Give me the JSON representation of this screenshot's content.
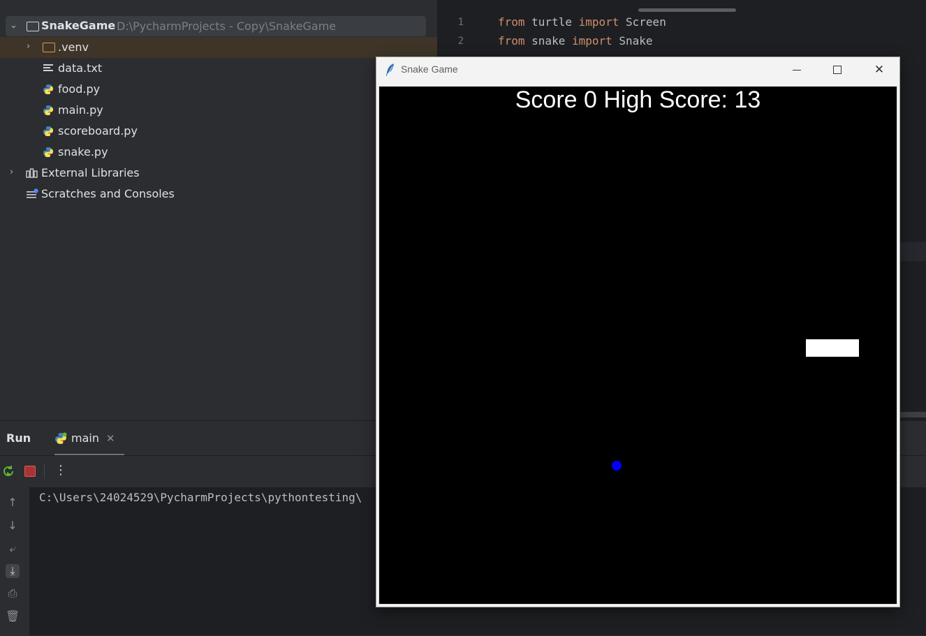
{
  "project": {
    "root_name": "SnakeGame",
    "root_path": "D:\\PycharmProjects - Copy\\SnakeGame",
    "items": [
      {
        "label": ".venv"
      },
      {
        "label": "data.txt"
      },
      {
        "label": "food.py"
      },
      {
        "label": "main.py"
      },
      {
        "label": "scoreboard.py"
      },
      {
        "label": "snake.py"
      }
    ],
    "external_libraries": "External Libraries",
    "scratches": "Scratches and Consoles"
  },
  "editor": {
    "lines": [
      {
        "num": "1",
        "kw1": "from",
        "mod": " turtle ",
        "kw2": "import",
        "name": " Screen"
      },
      {
        "num": "2",
        "kw1": "from",
        "mod": " snake ",
        "kw2": "import",
        "name": " Snake"
      }
    ]
  },
  "run": {
    "title": "Run",
    "tab_label": "main",
    "console_text": "C:\\Users\\24024529\\PycharmProjects\\pythontesting\\"
  },
  "game_window": {
    "title": "Snake Game",
    "score_text": "Score 0 High Score: 13",
    "colors": {
      "background": "#000000",
      "food": "#0000ff",
      "snake": "#ffffff"
    }
  }
}
